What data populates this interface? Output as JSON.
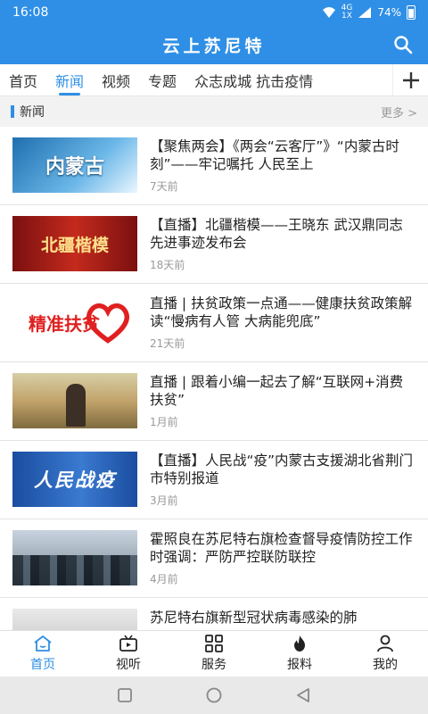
{
  "status_bar": {
    "time": "16:08",
    "network": "4G",
    "network_sub": "1X",
    "battery": "74%"
  },
  "header": {
    "title": "云上苏尼特"
  },
  "tabs": [
    {
      "label": "首页",
      "active": false
    },
    {
      "label": "新闻",
      "active": true
    },
    {
      "label": "视频",
      "active": false
    },
    {
      "label": "专题",
      "active": false
    },
    {
      "label": "众志成城 抗击疫情",
      "active": false
    }
  ],
  "section": {
    "label": "新闻",
    "more": "更多 >"
  },
  "news": [
    {
      "title": "【聚焦两会】《两会“云客厅”》“内蒙古时刻”——牢记嘱托 人民至上",
      "time": "7天前",
      "thumb_text": "内蒙古"
    },
    {
      "title": "【直播】北疆楷模——王晓东 武汉鼎同志先进事迹发布会",
      "time": "18天前",
      "thumb_text": "北疆楷模"
    },
    {
      "title": "直播 | 扶贫政策一点通——健康扶贫政策解读“慢病有人管 大病能兜底”",
      "time": "21天前",
      "thumb_text": "精准扶贫"
    },
    {
      "title": "直播 | 跟着小编一起去了解“互联网+消费扶贫”",
      "time": "1月前",
      "thumb_text": ""
    },
    {
      "title": "【直播】人民战“疫”内蒙古支援湖北省荆门市特别报道",
      "time": "3月前",
      "thumb_text": "人民战疫"
    },
    {
      "title": "霍照良在苏尼特右旗检查督导疫情防控工作时强调：严防严控联防联控",
      "time": "4月前",
      "thumb_text": ""
    },
    {
      "title": "苏尼特右旗新型冠状病毒感染的肺",
      "time": "",
      "thumb_text": ""
    }
  ],
  "bottom_nav": [
    {
      "label": "首页",
      "icon": "home-icon",
      "active": true
    },
    {
      "label": "视听",
      "icon": "tv-icon",
      "active": false
    },
    {
      "label": "服务",
      "icon": "grid-icon",
      "active": false
    },
    {
      "label": "报料",
      "icon": "flame-icon",
      "active": false
    },
    {
      "label": "我的",
      "icon": "person-icon",
      "active": false
    }
  ],
  "colors": {
    "accent": "#2f8fe6",
    "header_bg": "#2f8fe6",
    "muted": "#999999"
  }
}
